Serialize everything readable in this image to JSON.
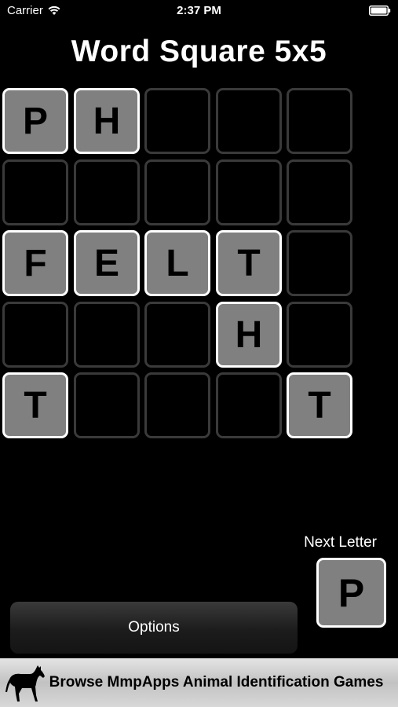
{
  "status_bar": {
    "carrier": "Carrier",
    "time": "2:37 PM",
    "wifi_icon": "wifi-icon",
    "battery_icon": "battery-icon"
  },
  "title": "Word Square 5x5",
  "grid": {
    "rows": [
      [
        "P",
        "H",
        "",
        "",
        ""
      ],
      [
        "",
        "",
        "",
        "",
        ""
      ],
      [
        "F",
        "E",
        "L",
        "T",
        ""
      ],
      [
        "",
        "",
        "",
        "H",
        ""
      ],
      [
        "T",
        "",
        "",
        "",
        "T"
      ]
    ]
  },
  "next_letter": {
    "label": "Next Letter",
    "value": "P"
  },
  "options_button": {
    "label": "Options"
  },
  "ad_banner": {
    "text": "Browse MmpApps Animal Identification Games",
    "icon": "horse-icon"
  },
  "colors": {
    "background": "#000000",
    "tile_filled": "#808080",
    "tile_border_filled": "#ffffff",
    "tile_border_empty": "#3a3a3a"
  }
}
